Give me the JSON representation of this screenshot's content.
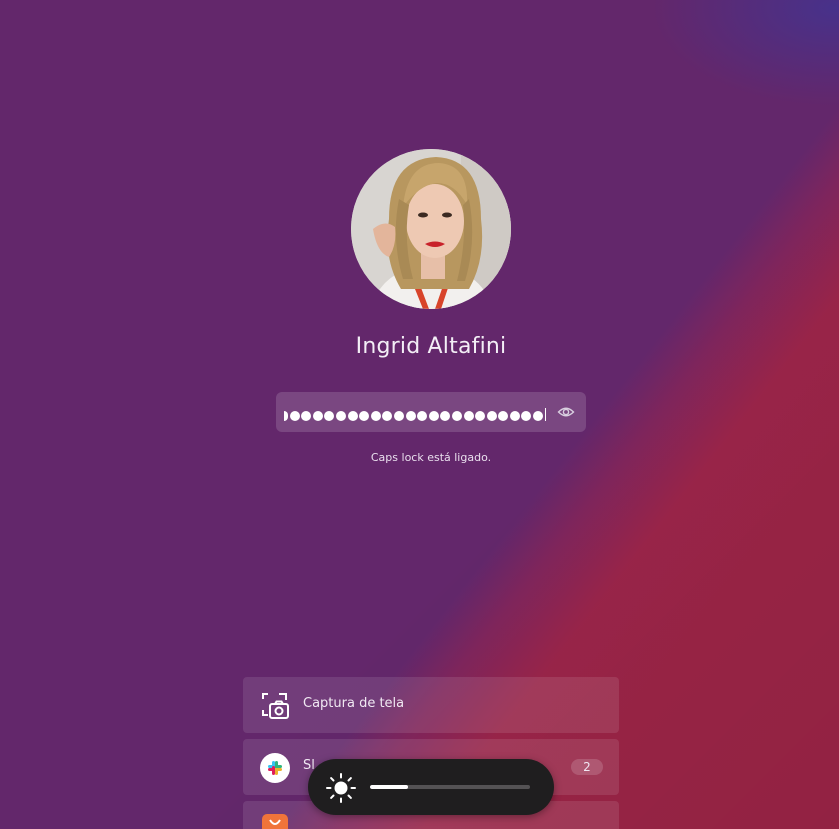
{
  "user": {
    "name": "Ingrid Altafini"
  },
  "password": {
    "masked_length": 23,
    "caps_lock_warning": "Caps lock está ligado."
  },
  "notifications": [
    {
      "app": "Captura de tela",
      "icon": "screenshot-icon"
    },
    {
      "app": "Sl",
      "icon": "slack-icon",
      "count": "2"
    },
    {
      "app": "",
      "icon": "shop-bag-icon"
    }
  ],
  "osd": {
    "type": "brightness",
    "icon": "sun-icon",
    "level": 0.24
  },
  "colors": {
    "background": "#63276b",
    "accent_corner": "#9a2446",
    "osd_background": "#1f1e1f"
  }
}
